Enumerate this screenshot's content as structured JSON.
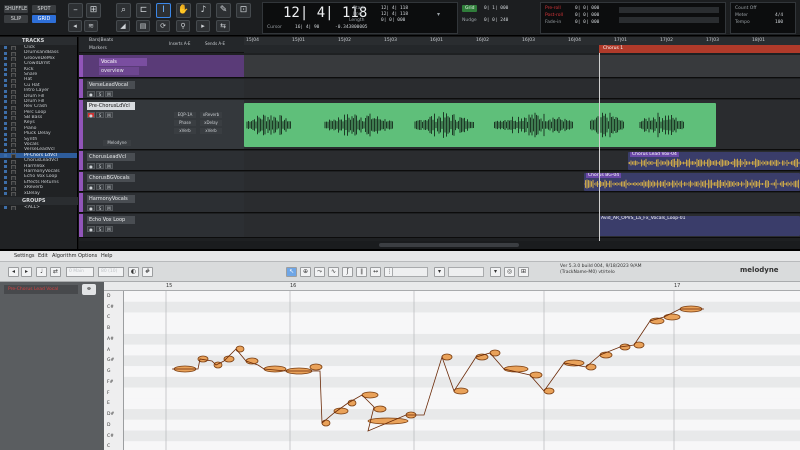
{
  "transport": {
    "modes": [
      "SHUFFLE",
      "SPOT",
      "SLIP",
      "GRID"
    ],
    "active_mode": "GRID",
    "counter": "12| 4| 118",
    "counter_icon": "triangle-down",
    "cursor_label": "Cursor",
    "cursor_value": "16| 4| 90",
    "db_value": "-0.343800005",
    "start_label": "Start",
    "end_label": "End",
    "length_label": "Length",
    "start": "12| 4| 118",
    "end": "12| 4| 118",
    "length": "0| 0| 000",
    "grid_label": "Grid",
    "grid_value": "0| 1| 000",
    "nudge_label": "Nudge",
    "nudge_value": "0| 0| 240",
    "pre_roll_label": "Pre-roll",
    "post_roll_label": "Post-roll",
    "fade_in_label": "Fade-in",
    "pre_roll": "0| 0| 000",
    "post_roll": "0| 0| 000",
    "fade_in": "0| 0| 000",
    "count_off_label": "Count Off",
    "meter_label": "Meter",
    "tempo_label": "Tempo",
    "meter_value": "4/4",
    "tempo_value": "100"
  },
  "sidebar": {
    "tracks_header": "TRACKS",
    "tracks": [
      "Click",
      "DrumsandBass",
      "GrooveDeMix",
      "CrowdDrmt",
      "Kick",
      "Snare",
      "Hat",
      "Cu Hat",
      "Intro Layer",
      "Drum Fill",
      "Drum Fill",
      "Rev Crash",
      "Perc Loop",
      "SB Bass",
      "Keys",
      "Piano",
      "Pluck Delay",
      "Synth",
      "Vocals",
      "VerseLeadVcl",
      "Pr-Chors LdVcl",
      "ChorusLeadVcl",
      "HarmVox",
      "HarmonyVocals",
      "Echo Vox Loop",
      "Effects Returns",
      "xReverb",
      "xDelay"
    ],
    "selected_index": 20,
    "groups_header": "GROUPS",
    "groups": [
      "<ALL>"
    ]
  },
  "edit": {
    "col_header": "Inserts A-E",
    "sends_header": "Sends A-E",
    "bars": [
      "15|04",
      "15|01",
      "15|02",
      "15|03",
      "16|01",
      "16|02",
      "16|03",
      "16|04",
      "17|01",
      "17|02",
      "17|03",
      "18|01"
    ],
    "marker": "Chorus 1",
    "tracks": [
      {
        "name": "VerseLeadVocal",
        "clip": ""
      },
      {
        "name": "Pre-ChorusLdVcl",
        "clip": "",
        "inserts": [
          "EQP-1A",
          "Phase",
          "xVerb"
        ],
        "sends": [
          "xReverb",
          "xDelay",
          "xVerb"
        ],
        "plugin": "Melodyne"
      },
      {
        "name": "ChorusLeadVcl",
        "clip": "Chorus Lead Vox-04"
      },
      {
        "name": "ChorusBGVocals",
        "clip": "Chorus BG-04"
      },
      {
        "name": "HarmonyVocals",
        "clip": ""
      },
      {
        "name": "Echo Vox Loop",
        "clip": "Avid_AR_OPVS_La_Fx_Vocals_Loop-01"
      }
    ],
    "folder": {
      "name": "Vocals",
      "sub": "overview"
    }
  },
  "melodyne": {
    "menu": [
      "Settings",
      "Edit",
      "Algorithm",
      "Options",
      "Help"
    ],
    "track_selector": "Pre-Chorus Lead Vocal",
    "status_line1": "Ver 5.3.0 build 004, 9/18/2023 9/AM",
    "status_line2": "(TrackName-M0) vt/rtelo",
    "logo": "melodyne",
    "zoom": "0 Main",
    "zoom2": "80 (10)",
    "ruler": [
      "15",
      "16",
      "17"
    ],
    "keys": [
      "D",
      "C#",
      "C",
      "B",
      "A#",
      "A",
      "G#",
      "G",
      "F#",
      "F",
      "E",
      "D#",
      "D",
      "C#",
      "C"
    ]
  }
}
